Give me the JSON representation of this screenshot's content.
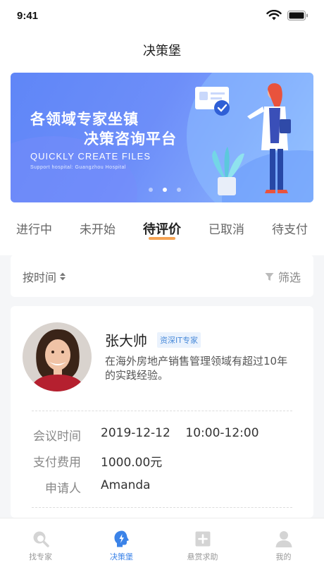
{
  "status_bar": {
    "time": "9:41"
  },
  "nav": {
    "title": "决策堡"
  },
  "banner": {
    "line1": "各领域专家坐镇",
    "line2": "决策咨询平台",
    "english": "QUICKLY CREATE FILES",
    "english_sub": "Support hospital: Guangzhou Hospital",
    "active_dot": 2
  },
  "tabs": [
    {
      "label": "进行中"
    },
    {
      "label": "未开始"
    },
    {
      "label": "待评价",
      "active": true
    },
    {
      "label": "已取消"
    },
    {
      "label": "待支付"
    }
  ],
  "filter_bar": {
    "sort_label": "按时间",
    "filter_label": "筛选"
  },
  "expert": {
    "name": "张大帅",
    "tag": "资深IT专家",
    "description": "在海外房地产销售管理领域有超过10年的实践经验。",
    "meeting_time_label": "会议时间",
    "meeting_time_value": "2019-12-12    10:00-12:00",
    "fee_label": "支付费用",
    "fee_value": "1000.00元",
    "applicant_label": "申请人",
    "applicant_value": "Amanda"
  },
  "tabbar": [
    {
      "label": "找专家",
      "icon": "search-expert-icon"
    },
    {
      "label": "决策堡",
      "icon": "decision-icon",
      "active": true
    },
    {
      "label": "悬赏求助",
      "icon": "bounty-plus-icon"
    },
    {
      "label": "我的",
      "icon": "profile-icon"
    }
  ],
  "colors": {
    "accent": "#3b83e8",
    "tab_underline": "#f5a353",
    "banner": "#6d8ef9"
  }
}
